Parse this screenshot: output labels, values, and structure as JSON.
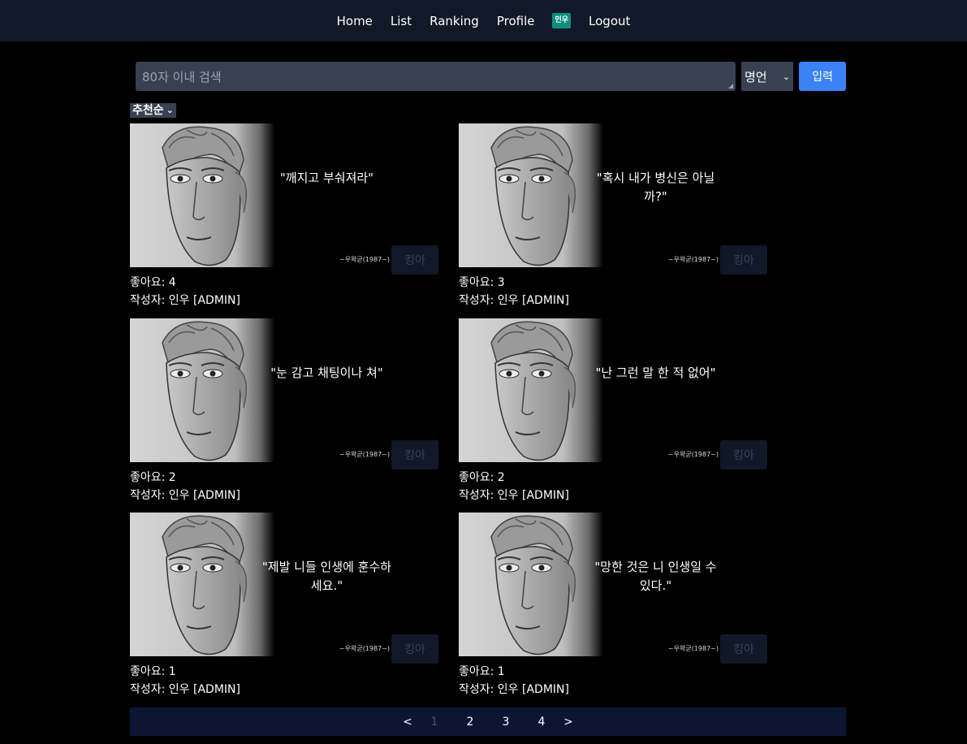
{
  "nav": {
    "home": "Home",
    "list": "List",
    "ranking": "Ranking",
    "profile": "Profile",
    "user_badge": "인우",
    "logout": "Logout"
  },
  "search": {
    "placeholder": "80자 이내 검색",
    "category_selected": "명언",
    "submit_label": "입력"
  },
  "sort": {
    "selected": "추천순"
  },
  "quotes": [
    {
      "text": "\"깨지고 부숴져라\"",
      "attribution": "~우왁굳(1987~)",
      "button": "킹아",
      "likes_label": "좋아요: 4",
      "author_label": "작성자: 인우 [ADMIN]"
    },
    {
      "text": "\"혹시 내가 병신은 아닐까?\"",
      "attribution": "~우왁굳(1987~)",
      "button": "킹아",
      "likes_label": "좋아요: 3",
      "author_label": "작성자: 인우 [ADMIN]"
    },
    {
      "text": "\"눈 감고 채팅이나 쳐\"",
      "attribution": "~우왁굳(1987~)",
      "button": "킹아",
      "likes_label": "좋아요: 2",
      "author_label": "작성자: 인우 [ADMIN]"
    },
    {
      "text": "\"난 그런 말 한 적 없어\"",
      "attribution": "~우왁굳(1987~)",
      "button": "킹아",
      "likes_label": "좋아요: 2",
      "author_label": "작성자: 인우 [ADMIN]"
    },
    {
      "text": "\"제발 니들 인생에 훈수하세요.\"",
      "attribution": "~우왁굳(1987~)",
      "button": "킹아",
      "likes_label": "좋아요: 1",
      "author_label": "작성자: 인우 [ADMIN]"
    },
    {
      "text": "\"망한 것은 니 인생일 수 있다.\"",
      "attribution": "~우왁굳(1987~)",
      "button": "킹아",
      "likes_label": "좋아요: 1",
      "author_label": "작성자: 인우 [ADMIN]"
    }
  ],
  "pagination": {
    "prev": "<",
    "pages": [
      "1",
      "2",
      "3",
      "4"
    ],
    "current": "1",
    "next": ">"
  }
}
